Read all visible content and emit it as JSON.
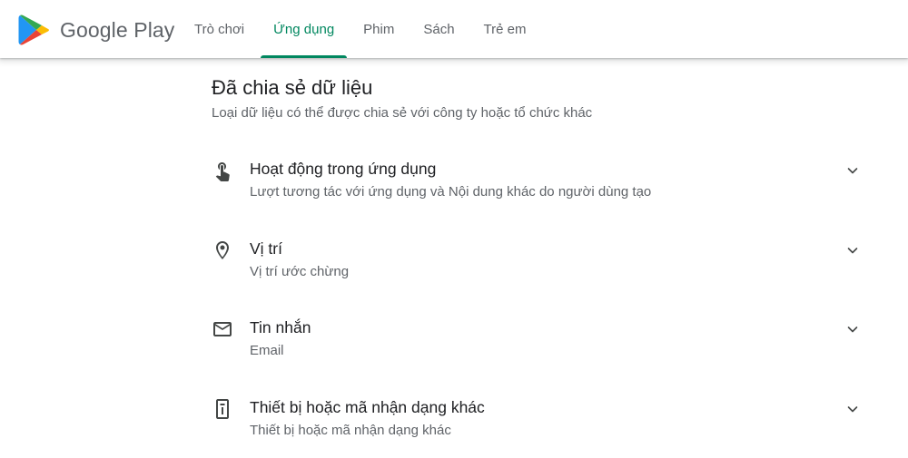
{
  "header": {
    "logo_text": "Google Play",
    "tabs": [
      {
        "label": "Trò chơi",
        "active": false
      },
      {
        "label": "Ứng dụng",
        "active": true
      },
      {
        "label": "Phim",
        "active": false
      },
      {
        "label": "Sách",
        "active": false
      },
      {
        "label": "Trẻ em",
        "active": false
      }
    ],
    "accent_color": "#01875f"
  },
  "section": {
    "title": "Đã chia sẻ dữ liệu",
    "subtitle": "Loại dữ liệu có thể được chia sẻ với công ty hoặc tổ chức khác",
    "items": [
      {
        "icon": "touch-icon",
        "title": "Hoạt động trong ứng dụng",
        "subtitle": "Lượt tương tác với ứng dụng và Nội dung khác do người dùng tạo"
      },
      {
        "icon": "location-icon",
        "title": "Vị trí",
        "subtitle": "Vị trí ước chừng"
      },
      {
        "icon": "mail-icon",
        "title": "Tin nhắn",
        "subtitle": "Email"
      },
      {
        "icon": "device-id-icon",
        "title": "Thiết bị hoặc mã nhận dạng khác",
        "subtitle": "Thiết bị hoặc mã nhận dạng khác"
      }
    ]
  }
}
